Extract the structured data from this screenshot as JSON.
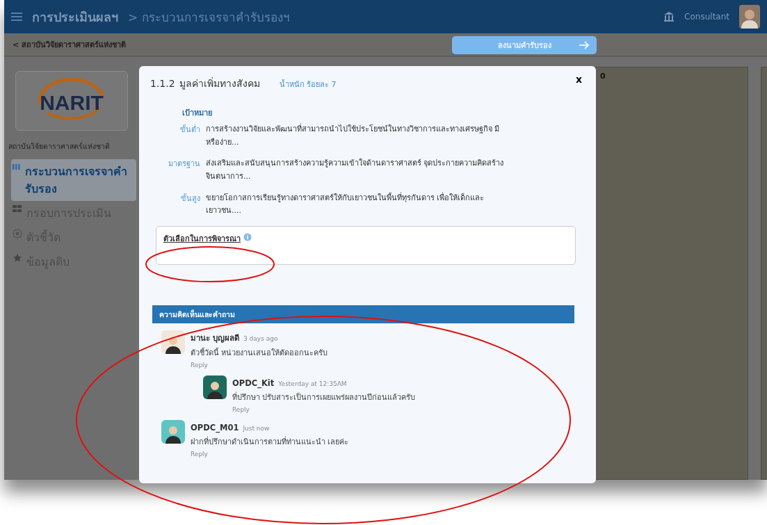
{
  "header": {
    "title": "การประเมินผลฯ",
    "breadcrumb": "> กระบวนการเจรจาคำรับรองฯ",
    "user": "Consultant"
  },
  "subheader": {
    "back": "< สถาบันวิจัยดาราศาสตร์แห่งชาติ",
    "button": "ลงนามคำรับรอง"
  },
  "sidebar": {
    "logo": "NARIT",
    "org": "สถาบันวิจัยดาราศาสตร์แห่งชาติ",
    "items": [
      {
        "kind": "bars",
        "label": "กระบวนการเจรจาคำรับรอง",
        "selected": true
      },
      {
        "kind": "grid",
        "label": "กรอบการประเมิน",
        "selected": false
      },
      {
        "kind": "target",
        "label": "ตัวชี้วัด",
        "selected": false
      },
      {
        "kind": "star",
        "label": "ข้อมูลดิบ",
        "selected": false
      }
    ]
  },
  "cards": [
    {
      "value": "0"
    }
  ],
  "modal": {
    "close": "x",
    "code": "1.1.2",
    "title": "มูลค่าเพิ่มทางสังคม",
    "weight": "น้ำหนัก ร้อยละ 7",
    "goal_label": "เป้าหมาย",
    "goals": [
      {
        "level": "ขั้นต่ำ",
        "text": "การสร้างงานวิจัยและพัฒนาที่สามารถนำไปใช้ประโยชน์ในทางวิชาการและทางเศรษฐกิจ มีหรือง่าย..."
      },
      {
        "level": "มาตรฐาน",
        "text": "ส่งเสริมและสนับสนุนการสร้างความรู้ความเข้าใจด้านดาราศาสตร์ จุดประกายความคิดสร้างจินตนาการ..."
      },
      {
        "level": "ขั้นสูง",
        "text": "ขยายโอกาสการเรียนรู้ทางดาราศาสตร์ให้กับเยาวชนในพื้นที่ทุรกันดาร เพื่อให้เด็กและเยาวชน...."
      }
    ],
    "field_label": "ตัวเลือกในการพิจารณา",
    "comments_title": "ความคิดเห็นและคำถาม",
    "comments": [
      {
        "author": "มานะ บุญผลดี",
        "time": "3 days ago",
        "text": "ตัวชี้วัดนี้ หน่วยงานเสนอให้ตัดออกนะครับ",
        "reply": "Reply",
        "color": "#f2e6d8",
        "children": [
          {
            "author": "OPDC_Kit",
            "time": "Yesterday at 12:35AM",
            "text": "ที่ปรึกษา ปรับสาระเป็นการเผยแพร่ผลงานปีก่อนแล้วครับ",
            "reply": "Reply",
            "color": "#1d6b5c"
          }
        ]
      },
      {
        "author": "OPDC_M01",
        "time": "Just now",
        "text": "ฝากที่ปรึกษาดำเนินการตามที่ท่านแนะนำ เลยค่ะ",
        "reply": "Reply",
        "color": "#5fc4c4"
      }
    ]
  }
}
